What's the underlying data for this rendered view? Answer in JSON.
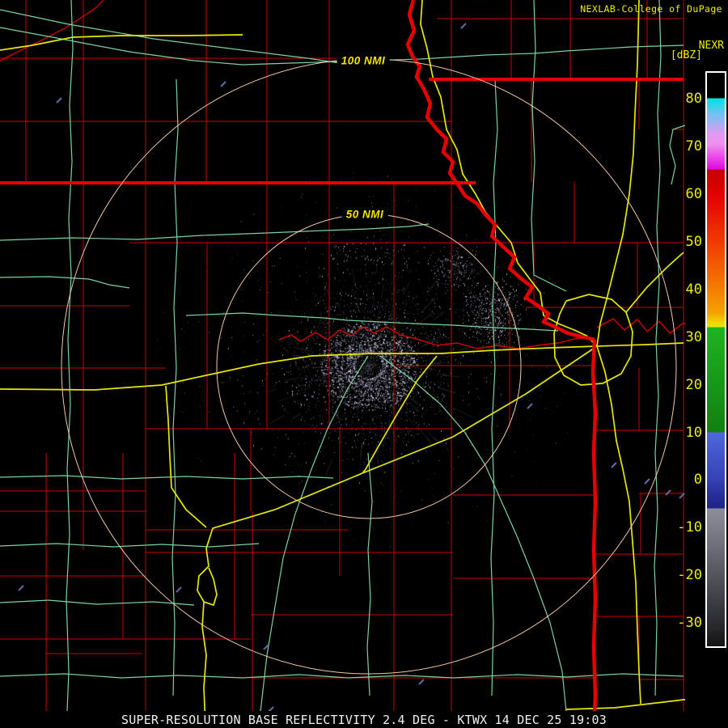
{
  "header": {
    "brand": "NEXLAB-College of DuPage",
    "popout_icon": "popout-window-icon"
  },
  "scale": {
    "product_label": "NEXR",
    "units_label": "[dBZ]",
    "tick_values": [
      80,
      70,
      60,
      50,
      40,
      30,
      20,
      10,
      0,
      -10,
      -20,
      -30
    ],
    "gradient_stops": [
      [
        0,
        "#000000"
      ],
      [
        31,
        "#000000"
      ],
      [
        32,
        "#00E2E2"
      ],
      [
        50,
        "#6FC2F0"
      ],
      [
        62,
        "#9FB2F2"
      ],
      [
        75,
        "#E09AF2"
      ],
      [
        88,
        "#F090F0"
      ],
      [
        103,
        "#EC4CEC"
      ],
      [
        119,
        "#DF0ADF"
      ],
      [
        120,
        "#C60000"
      ],
      [
        150,
        "#E40000"
      ],
      [
        209,
        "#F23A00"
      ],
      [
        268,
        "#F57E00"
      ],
      [
        297,
        "#F5A300"
      ],
      [
        308,
        "#F0D400"
      ],
      [
        314,
        "#EFE400"
      ],
      [
        315,
        "#1EB41E"
      ],
      [
        380,
        "#189A18"
      ],
      [
        444,
        "#108010"
      ],
      [
        445,
        "#4E68DC"
      ],
      [
        503,
        "#3442B4"
      ],
      [
        522,
        "#272F9A"
      ],
      [
        538,
        "#1E2386"
      ],
      [
        539,
        "#8E8E9A"
      ],
      [
        562,
        "#7F7F8B"
      ],
      [
        621,
        "#54545D"
      ],
      [
        680,
        "#2B2B31"
      ],
      [
        709,
        "#131315"
      ]
    ],
    "bar_inner_height": 709
  },
  "rings": {
    "outer_label": "100 NMI",
    "inner_label": "50 NMI"
  },
  "caption": "SUPER-RESOLUTION BASE REFLECTIVITY 2.4 DEG - KTWX 14 DEC 25 19:03",
  "colors": {
    "county": "#CC0000",
    "state_border": "#E80000",
    "river": "#D40000",
    "highway_green": "#7CD2A2",
    "interstate_yellow": "#E8E800",
    "range_ring": "#F5C9A4",
    "label_yellow": "#EDED00",
    "caption_white": "#EFEFEF",
    "echo_clutter": "#8C8CA3",
    "spurious_echo": "#6868A8"
  }
}
